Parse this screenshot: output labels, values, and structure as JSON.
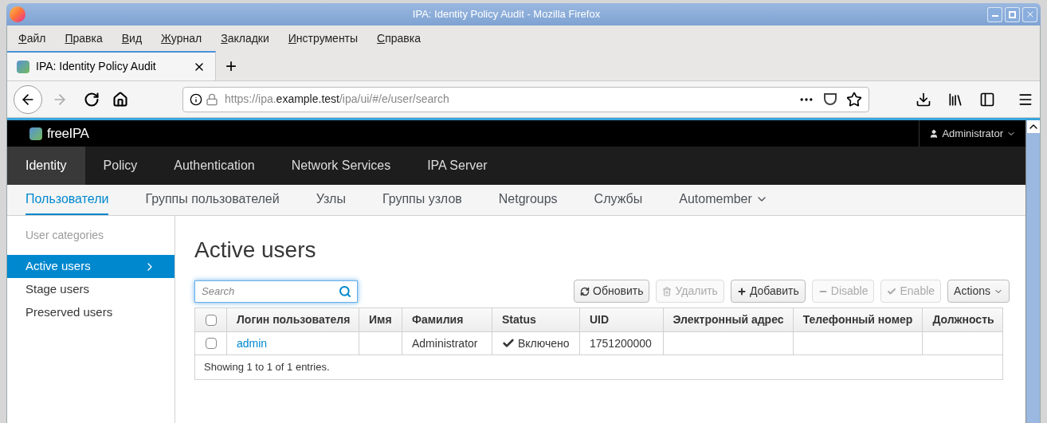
{
  "window": {
    "title": "IPA: Identity Policy Audit - Mozilla Firefox"
  },
  "menu": [
    {
      "accel": "Ф",
      "rest": "айл"
    },
    {
      "accel": "П",
      "rest": "равка"
    },
    {
      "accel": "В",
      "rest": "ид"
    },
    {
      "accel": "Ж",
      "rest": "урнал"
    },
    {
      "accel": "З",
      "rest": "акладки"
    },
    {
      "accel": "И",
      "rest": "нструменты"
    },
    {
      "accel": "С",
      "rest": "правка"
    }
  ],
  "browser_tabs": [
    {
      "label": "IPA: Identity Policy Audit",
      "selected": true
    }
  ],
  "new_tab": "+",
  "url": {
    "prefix": "https://ipa.",
    "host": "example.test",
    "path": "/ipa/ui/#/e/user/search"
  },
  "app": {
    "brand": "freeIPA",
    "user": "Administrator"
  },
  "main_nav": [
    {
      "label": "Identity",
      "selected": true
    },
    {
      "label": "Policy",
      "selected": false
    },
    {
      "label": "Authentication",
      "selected": false
    },
    {
      "label": "Network Services",
      "selected": false
    },
    {
      "label": "IPA Server",
      "selected": false
    }
  ],
  "sub_nav": [
    {
      "label": "Пользователи",
      "selected": true,
      "dropdown": false
    },
    {
      "label": "Группы пользователей",
      "selected": false,
      "dropdown": false
    },
    {
      "label": "Узлы",
      "selected": false,
      "dropdown": false
    },
    {
      "label": "Группы узлов",
      "selected": false,
      "dropdown": false
    },
    {
      "label": "Netgroups",
      "selected": false,
      "dropdown": false
    },
    {
      "label": "Службы",
      "selected": false,
      "dropdown": false
    },
    {
      "label": "Automember",
      "selected": false,
      "dropdown": true
    }
  ],
  "sidebar": {
    "heading": "User categories",
    "items": [
      {
        "label": "Active users",
        "selected": true
      },
      {
        "label": "Stage users",
        "selected": false
      },
      {
        "label": "Preserved users",
        "selected": false
      }
    ]
  },
  "page_title": "Active users",
  "search": {
    "placeholder": "Search"
  },
  "actions": [
    {
      "kind": "refresh",
      "label": "Обновить",
      "disabled": false
    },
    {
      "kind": "delete",
      "label": "Удалить",
      "disabled": true
    },
    {
      "kind": "add",
      "label": "Добавить",
      "disabled": false
    },
    {
      "kind": "disable",
      "label": "Disable",
      "disabled": true
    },
    {
      "kind": "enable",
      "label": "Enable",
      "disabled": true
    },
    {
      "kind": "menu",
      "label": "Actions",
      "disabled": false
    }
  ],
  "table": {
    "all_checked": false,
    "columns": [
      "Логин пользователя",
      "Имя",
      "Фамилия",
      "Status",
      "UID",
      "Электронный адрес",
      "Телефонный номер",
      "Должность"
    ],
    "rows": [
      {
        "checked": false,
        "login": "admin",
        "first_name": "",
        "last_name": "Administrator",
        "status": "Включено",
        "enabled": true,
        "uid": "1751200000",
        "email": "",
        "phone": "",
        "title": ""
      }
    ],
    "footer": "Showing 1 to 1 of 1 entries."
  }
}
